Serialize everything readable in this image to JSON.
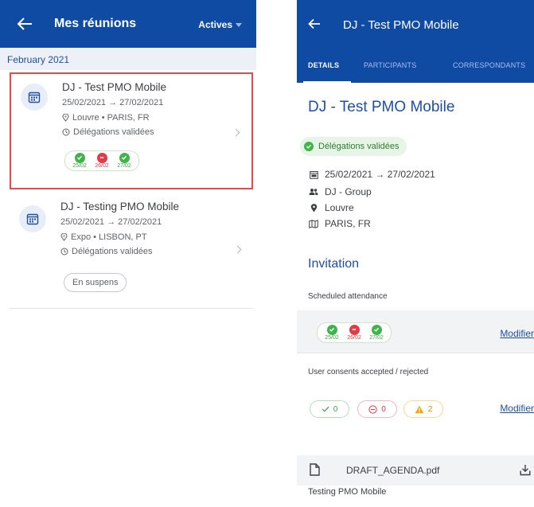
{
  "left": {
    "header": {
      "title": "Mes réunions",
      "filter": "Actives"
    },
    "month": "February 2021",
    "meetings": [
      {
        "title": "DJ - Test PMO Mobile",
        "dates": "25/02/2021 → 27/02/2021",
        "location": "Louvre • PARIS, FR",
        "status": "Délégations validées",
        "days": [
          {
            "label": "25/02",
            "state": "ok"
          },
          {
            "label": "26/02",
            "state": "no"
          },
          {
            "label": "27/02",
            "state": "ok"
          }
        ]
      },
      {
        "title": "DJ - Testing PMO Mobile",
        "dates": "25/02/2021 → 27/02/2021",
        "location": "Expo • LISBON, PT",
        "status": "Délégations validées",
        "badge": "En suspens"
      }
    ]
  },
  "right": {
    "header": {
      "title": "DJ - Test PMO Mobile"
    },
    "tabs": [
      "DETAILS",
      "PARTICIPANTS",
      "CORRESPONDANTS"
    ],
    "meeting_title": "DJ - Test PMO Mobile",
    "status_badge": "Délégations validées",
    "details": {
      "dates": "25/02/2021 → 27/02/2021",
      "group": "DJ - Group",
      "venue": "Louvre",
      "city": "PARIS, FR"
    },
    "invitation": {
      "heading": "Invitation",
      "attendance_label": "Scheduled attendance",
      "days": [
        {
          "label": "25/02",
          "state": "ok"
        },
        {
          "label": "26/02",
          "state": "no"
        },
        {
          "label": "27/02",
          "state": "ok"
        }
      ],
      "modify_label": "Modifier",
      "consents_label": "User consents accepted / rejected",
      "consents": {
        "accepted": "0",
        "rejected": "0",
        "warning": "2"
      },
      "modify_label_2": "Modifier"
    },
    "file": {
      "name": "DRAFT_AGENDA.pdf"
    },
    "footer": "Testing PMO Mobile"
  },
  "colors": {
    "brand_blue": "#0f4aa3",
    "accent_blue": "#1f4f9e",
    "ok_green": "#3fb44b",
    "reject_red": "#e53945",
    "warning_orange": "#f4a300",
    "highlight_border": "#dd4f4f"
  }
}
